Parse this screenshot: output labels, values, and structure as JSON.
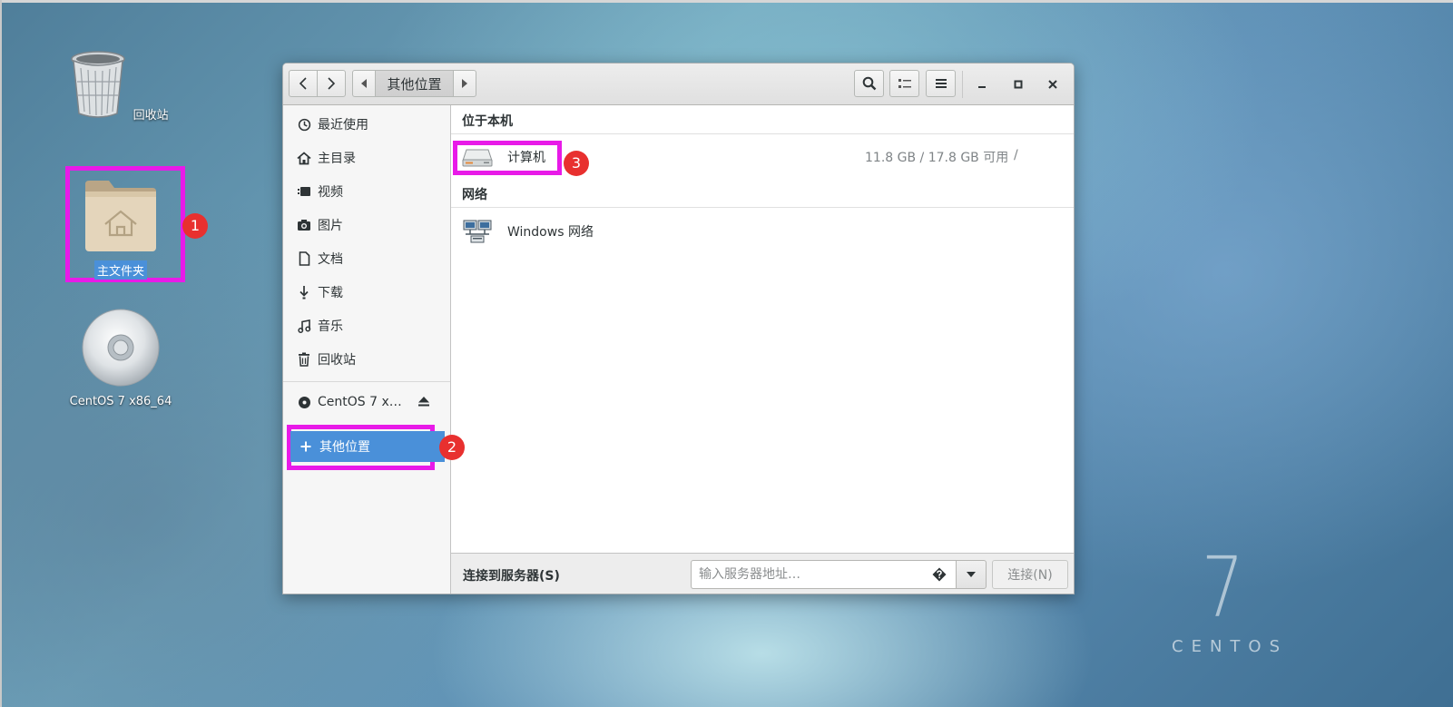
{
  "desktop": {
    "icons": [
      {
        "label": "回收站"
      },
      {
        "label": "主文件夹"
      },
      {
        "label": "CentOS 7 x86_64"
      }
    ],
    "brand_number": "7",
    "brand_text": "CENTOS"
  },
  "annotations": {
    "badge1": "1",
    "badge2": "2",
    "badge3": "3",
    "highlight_color": "#e81ae8",
    "badge_color": "#e8302f"
  },
  "window": {
    "path_current": "其他位置",
    "sidebar": {
      "items": [
        {
          "label": "最近使用",
          "icon": "clock-icon"
        },
        {
          "label": "主目录",
          "icon": "home-icon"
        },
        {
          "label": "视频",
          "icon": "video-icon"
        },
        {
          "label": "图片",
          "icon": "camera-icon"
        },
        {
          "label": "文档",
          "icon": "document-icon"
        },
        {
          "label": "下载",
          "icon": "download-icon"
        },
        {
          "label": "音乐",
          "icon": "music-icon"
        },
        {
          "label": "回收站",
          "icon": "trash-icon"
        }
      ],
      "device": {
        "label": "CentOS 7 x…",
        "icon": "disc-icon"
      },
      "other_locations": {
        "label": "其他位置",
        "icon": "plus-icon"
      }
    },
    "content": {
      "section_local": "位于本机",
      "computer": {
        "label": "计算机",
        "usage": "11.8 GB / 17.8 GB 可用",
        "path": "/"
      },
      "section_network": "网络",
      "network_item": {
        "label": "Windows 网络"
      }
    },
    "footer": {
      "label": "连接到服务器(S)",
      "input_placeholder": "输入服务器地址…",
      "connect_label": "连接(N)"
    },
    "accent_color": "#4a90d9"
  }
}
